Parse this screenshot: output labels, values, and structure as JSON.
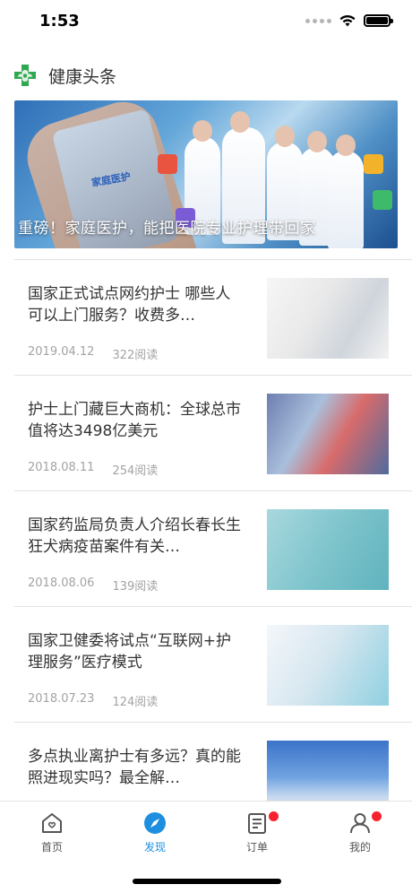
{
  "status_bar": {
    "time": "1:53"
  },
  "header": {
    "title": "健康头条"
  },
  "banner": {
    "caption": "重磅！家庭医护，能把医院专业护理带回家",
    "logo_text": "家庭医护"
  },
  "news": [
    {
      "title": "国家正式试点网约护士 哪些人可以上门服务？收费多…",
      "date": "2019.04.12",
      "reads": "322阅读"
    },
    {
      "title": "护士上门藏巨大商机：全球总市值将达3498亿美元",
      "date": "2018.08.11",
      "reads": "254阅读"
    },
    {
      "title": "国家药监局负责人介绍长春长生狂犬病疫苗案件有关…",
      "date": "2018.08.06",
      "reads": "139阅读"
    },
    {
      "title": "国家卫健委将试点“互联网+护理服务”医疗模式",
      "date": "2018.07.23",
      "reads": "124阅读"
    },
    {
      "title": "多点执业离护士有多远？真的能照进现实吗？最全解…",
      "date": "",
      "reads": ""
    }
  ],
  "tabs": [
    {
      "label": "首页",
      "icon": "home-icon",
      "active": false
    },
    {
      "label": "发现",
      "icon": "compass-icon",
      "active": true
    },
    {
      "label": "订单",
      "icon": "order-icon",
      "active": false,
      "badge": true
    },
    {
      "label": "我的",
      "icon": "profile-icon",
      "active": false,
      "badge": true
    }
  ],
  "colors": {
    "accent": "#1e8fe0",
    "badge": "#f5222d",
    "header_icon": "#2fa84f"
  }
}
